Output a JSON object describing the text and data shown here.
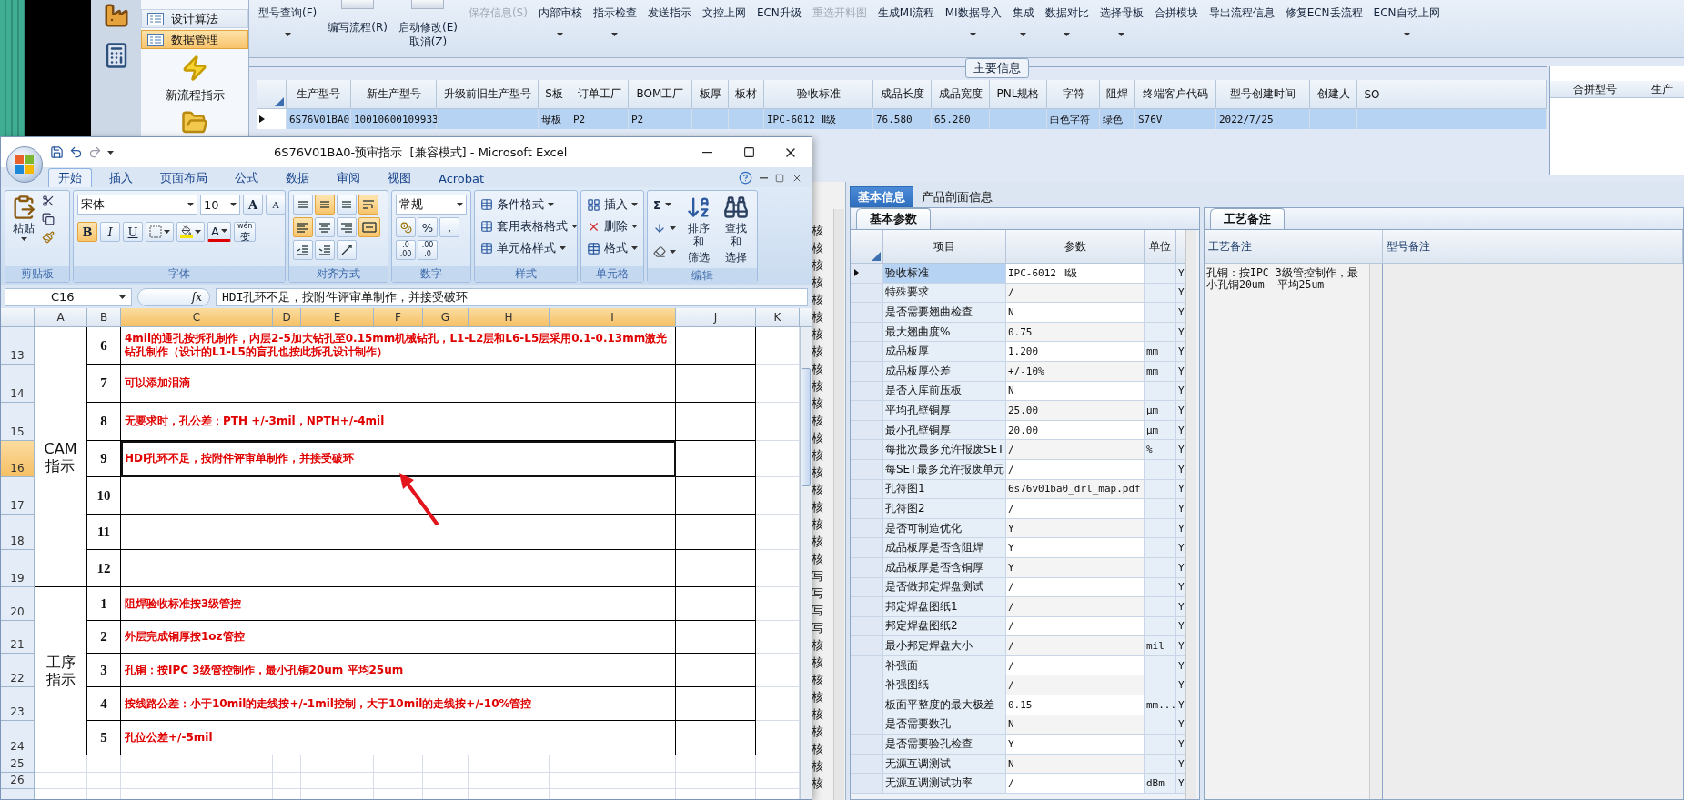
{
  "nav": {
    "items": [
      {
        "label": "设计算法",
        "selected": false
      },
      {
        "label": "数据管理",
        "selected": true
      }
    ],
    "shortcuts": [
      {
        "kind": "lightning",
        "label": "新流程指示"
      },
      {
        "kind": "folder"
      }
    ],
    "side_icons": [
      {
        "kind": "factory"
      },
      {
        "kind": "calculator"
      }
    ]
  },
  "toolbar": {
    "buttons": [
      {
        "label": "型号查询(F)",
        "kind": "text",
        "dropdown": true,
        "disabled": false
      },
      {
        "label": "编写流程(R)",
        "kind": "large",
        "dropdown": false,
        "disabled": false
      },
      {
        "label": "启动修改(E)",
        "label_2": "取消(Z)",
        "kind": "large",
        "dropdown": false,
        "disabled": false
      },
      {
        "label": "保存信息(S)",
        "kind": "text",
        "dropdown": false,
        "disabled": true
      },
      {
        "label": "内部审核",
        "kind": "text",
        "dropdown": true,
        "disabled": false
      },
      {
        "label": "指示检查",
        "kind": "text",
        "dropdown": true,
        "disabled": false
      },
      {
        "label": "发送指示",
        "kind": "text",
        "dropdown": false,
        "disabled": false
      },
      {
        "label": "文控上网",
        "kind": "text",
        "dropdown": false,
        "disabled": false
      },
      {
        "label": "ECN升级",
        "kind": "text",
        "dropdown": false,
        "disabled": false
      },
      {
        "label": "重选开料图",
        "kind": "text",
        "dropdown": false,
        "disabled": true
      },
      {
        "label": "生成MI流程",
        "kind": "text",
        "dropdown": false,
        "disabled": false
      },
      {
        "label": "MI数据导入",
        "kind": "text",
        "dropdown": true,
        "disabled": false
      },
      {
        "label": "集成",
        "kind": "text",
        "dropdown": true,
        "disabled": false
      },
      {
        "label": "数据对比",
        "kind": "text",
        "dropdown": true,
        "disabled": false
      },
      {
        "label": "选择母板",
        "kind": "text",
        "dropdown": true,
        "disabled": false
      },
      {
        "label": "合拼模块",
        "kind": "text",
        "dropdown": false,
        "disabled": false
      },
      {
        "label": "导出流程信息",
        "kind": "text",
        "dropdown": false,
        "disabled": false
      },
      {
        "label": "修复ECN丢流程",
        "kind": "text",
        "dropdown": false,
        "disabled": false
      },
      {
        "label": "ECN自动上网",
        "kind": "text",
        "dropdown": true,
        "disabled": false
      }
    ]
  },
  "main_info": {
    "title": "主要信息",
    "columns": [
      "生产型号",
      "新生产型号",
      "升级前旧生产型号",
      "S板",
      "订单工厂",
      "BOM工厂",
      "板厚",
      "板材",
      "验收标准",
      "成品长度",
      "成品宽度",
      "PNL规格",
      "字符",
      "阻焊",
      "终端客户代码",
      "型号创建时间",
      "创建人",
      "SO"
    ],
    "rows": [
      {
        "selected": true,
        "cells": [
          "6S76V01BA0",
          "10010600109933",
          "",
          "母板",
          "P2",
          "P2",
          "",
          "",
          "IPC-6012 Ⅱ级",
          "76.580",
          "65.280",
          "",
          "白色字符",
          "绿色",
          "S76V",
          "2022/7/25",
          "",
          ""
        ]
      }
    ]
  },
  "merge_panel": {
    "columns": [
      "合拼型号",
      "生产"
    ]
  },
  "excel": {
    "title": "6S76V01BA0-预审指示  [兼容模式] - Microsoft Excel",
    "tabs": [
      {
        "label": "开始",
        "selected": true
      },
      {
        "label": "插入",
        "selected": false
      },
      {
        "label": "页面布局",
        "selected": false
      },
      {
        "label": "公式",
        "selected": false
      },
      {
        "label": "数据",
        "selected": false
      },
      {
        "label": "审阅",
        "selected": false
      },
      {
        "label": "视图",
        "selected": false
      },
      {
        "label": "Acrobat",
        "selected": false
      }
    ],
    "ribbon": {
      "clipboard": {
        "label": "剪贴板",
        "paste": "粘贴"
      },
      "font": {
        "label": "字体",
        "font": "宋体",
        "size": "10",
        "grow": "A",
        "shrink": "A",
        "styles": [
          {
            "label": "B",
            "selected": true
          },
          {
            "label": "I",
            "selected": false
          },
          {
            "label": "U",
            "selected": false
          }
        ],
        "font_color": "A",
        "phonetic": "wén",
        "phonetic_char": "变"
      },
      "alignment": {
        "label": "对齐方式",
        "buttons": [
          {
            "kind": "top",
            "selected": false
          },
          {
            "kind": "middle",
            "selected": true
          },
          {
            "kind": "bottom",
            "selected": false
          },
          {
            "kind": "wrap",
            "selected": true
          },
          {
            "kind": "left",
            "selected": true
          },
          {
            "kind": "center",
            "selected": false
          },
          {
            "kind": "right",
            "selected": false
          },
          {
            "kind": "merge",
            "selected": true
          },
          {
            "kind": "outdent",
            "selected": false
          },
          {
            "kind": "indent",
            "selected": false
          },
          {
            "kind": "orientation",
            "selected": false
          }
        ]
      },
      "number": {
        "label": "数字",
        "format": "常规",
        "symbols": [
          "%",
          ","
        ],
        "decimals": [
          {
            "top": ".0",
            "bottom": ".00"
          },
          {
            "top": ".00",
            "bottom": ".0"
          }
        ]
      },
      "styles": {
        "label": "样式",
        "items": [
          "条件格式",
          "套用表格格式",
          "单元格样式"
        ]
      },
      "cells": {
        "label": "单元格",
        "items": [
          {
            "kind": "insert",
            "label": "插入"
          },
          {
            "kind": "delete",
            "label": "删除"
          },
          {
            "kind": "format",
            "label": "格式"
          }
        ]
      },
      "editing": {
        "label": "编辑",
        "sum": "Σ",
        "buttons": [
          {
            "kind": "sort",
            "lines": [
              "排序和",
              "筛选"
            ]
          },
          {
            "kind": "find",
            "lines": [
              "查找和",
              "选择"
            ]
          }
        ]
      }
    },
    "name_box": "C16",
    "fx": "fx",
    "formula": "HDI孔环不足，按附件评审单制作，并接受破环",
    "columns": [
      {
        "label": "A",
        "selected": false
      },
      {
        "label": "B",
        "selected": false
      },
      {
        "label": "C",
        "selected": true
      },
      {
        "label": "D",
        "selected": true
      },
      {
        "label": "E",
        "selected": true
      },
      {
        "label": "F",
        "selected": true
      },
      {
        "label": "G",
        "selected": true
      },
      {
        "label": "H",
        "selected": true
      },
      {
        "label": "I",
        "selected": true
      },
      {
        "label": "J",
        "selected": false
      },
      {
        "label": "K",
        "selected": false
      }
    ],
    "sections": [
      {
        "label_lines": [
          "CAM",
          "指示"
        ],
        "rows": [
          {
            "row": "13",
            "no": "6",
            "text": "4mil的通孔按拆孔制作，内层2-5加大钻孔至0.15mm机械钻孔，L1-L2层和L6-L5层采用0.1-0.13mm激光钻孔制作（设计的L1-L5的盲孔也按此拆孔设计制作）",
            "selected": false
          },
          {
            "row": "14",
            "no": "7",
            "text": "可以添加泪滴",
            "selected": false
          },
          {
            "row": "15",
            "no": "8",
            "text": "无要求时，孔公差：PTH +/-3mil，NPTH+/-4mil",
            "selected": false
          },
          {
            "row": "16",
            "no": "9",
            "text": "HDI孔环不足，按附件评审单制作，并接受破环",
            "selected": true
          },
          {
            "row": "17",
            "no": "10",
            "text": "",
            "selected": false
          },
          {
            "row": "18",
            "no": "11",
            "text": "",
            "selected": false
          },
          {
            "row": "19",
            "no": "12",
            "text": "",
            "selected": false
          }
        ]
      },
      {
        "label_lines": [
          "工序",
          "指示"
        ],
        "rows": [
          {
            "row": "20",
            "no": "1",
            "text": "阻焊验收标准按3级管控",
            "selected": false
          },
          {
            "row": "21",
            "no": "2",
            "text": "外层完成铜厚按1oz管控",
            "selected": false
          },
          {
            "row": "22",
            "no": "3",
            "text": "孔铜：按IPC 3级管控制作，最小孔铜20um  平均25um",
            "selected": false
          },
          {
            "row": "23",
            "no": "4",
            "text": "按线路公差：小于10mil的走线按+/-1mil控制，大于10mil的走线按+/-10%管控",
            "selected": false
          },
          {
            "row": "24",
            "no": "5",
            "text": "孔位公差+/-5mil",
            "selected": false
          }
        ]
      }
    ],
    "empty_rows": [
      "25",
      "26"
    ]
  },
  "side_column": [
    "核",
    "核",
    "核",
    "核",
    "核",
    "核",
    "核",
    "核",
    "核",
    "核",
    "核",
    "核",
    "核",
    "核",
    "核",
    "核",
    "核",
    "核",
    "核",
    "核",
    "写",
    "写",
    "写",
    "写",
    "核",
    "核",
    "核",
    "核",
    "核",
    "核",
    "核",
    "核",
    "核"
  ],
  "detail_tabs": [
    {
      "label": "基本信息",
      "selected": true
    },
    {
      "label": "产品剖面信息",
      "selected": false
    }
  ],
  "params": {
    "tab": "基本参数",
    "columns": [
      "项目",
      "参数",
      "单位"
    ],
    "rows": [
      {
        "selected": true,
        "cells": [
          "验收标准",
          "IPC-6012 Ⅱ级",
          "",
          "Y"
        ]
      },
      {
        "selected": false,
        "cells": [
          "特殊要求",
          "/",
          "",
          "Y"
        ]
      },
      {
        "selected": false,
        "cells": [
          "是否需要翘曲检查",
          "N",
          "",
          "Y"
        ]
      },
      {
        "selected": false,
        "cells": [
          "最大翘曲度%",
          "0.75",
          "",
          "Y"
        ]
      },
      {
        "selected": false,
        "cells": [
          "成品板厚",
          "1.200",
          "mm",
          "Y"
        ]
      },
      {
        "selected": false,
        "cells": [
          "成品板厚公差",
          "+/-10%",
          "mm",
          "Y"
        ]
      },
      {
        "selected": false,
        "cells": [
          "是否入库前压板",
          "N",
          "",
          "Y"
        ]
      },
      {
        "selected": false,
        "cells": [
          "平均孔壁铜厚",
          "25.00",
          "μm",
          "Y"
        ]
      },
      {
        "selected": false,
        "cells": [
          "最小孔壁铜厚",
          "20.00",
          "μm",
          "Y"
        ]
      },
      {
        "selected": false,
        "cells": [
          "每批次最多允许报废SET",
          "/",
          "%",
          "Y"
        ]
      },
      {
        "selected": false,
        "cells": [
          "每SET最多允许报废单元",
          "/",
          "",
          "Y"
        ]
      },
      {
        "selected": false,
        "cells": [
          "孔符图1",
          "6s76v01ba0_drl_map.pdf",
          "",
          "Y"
        ]
      },
      {
        "selected": false,
        "cells": [
          "孔符图2",
          "/",
          "",
          "Y"
        ]
      },
      {
        "selected": false,
        "cells": [
          "是否可制造优化",
          "Y",
          "",
          "Y"
        ]
      },
      {
        "selected": false,
        "cells": [
          "成品板厚是否含阻焊",
          "Y",
          "",
          "Y"
        ]
      },
      {
        "selected": false,
        "cells": [
          "成品板厚是否含铜厚",
          "Y",
          "",
          "Y"
        ]
      },
      {
        "selected": false,
        "cells": [
          "是否做邦定焊盘测试",
          "/",
          "",
          "Y"
        ]
      },
      {
        "selected": false,
        "cells": [
          "邦定焊盘图纸1",
          "/",
          "",
          "Y"
        ]
      },
      {
        "selected": false,
        "cells": [
          "邦定焊盘图纸2",
          "/",
          "",
          "Y"
        ]
      },
      {
        "selected": false,
        "cells": [
          "最小邦定焊盘大小",
          "/",
          "mil",
          "Y"
        ]
      },
      {
        "selected": false,
        "cells": [
          "补强面",
          "/",
          "",
          "Y"
        ]
      },
      {
        "selected": false,
        "cells": [
          "补强图纸",
          "/",
          "",
          "Y"
        ]
      },
      {
        "selected": false,
        "cells": [
          "板面平整度的最大极差",
          "0.15",
          "mm...",
          "Y"
        ]
      },
      {
        "selected": false,
        "cells": [
          "是否需要数孔",
          "N",
          "",
          "Y"
        ]
      },
      {
        "selected": false,
        "cells": [
          "是否需要验孔检查",
          "Y",
          "",
          "Y"
        ]
      },
      {
        "selected": false,
        "cells": [
          "无源互调测试",
          "N",
          "",
          "Y"
        ]
      },
      {
        "selected": false,
        "cells": [
          "无源互调测试功率",
          "/",
          "dBm",
          "Y"
        ]
      }
    ]
  },
  "notes": {
    "tab": "工艺备注",
    "columns": [
      "工艺备注",
      "型号备注"
    ],
    "text": "孔铜：按IPC 3级管控制作，最小孔铜20um  平均25um"
  }
}
